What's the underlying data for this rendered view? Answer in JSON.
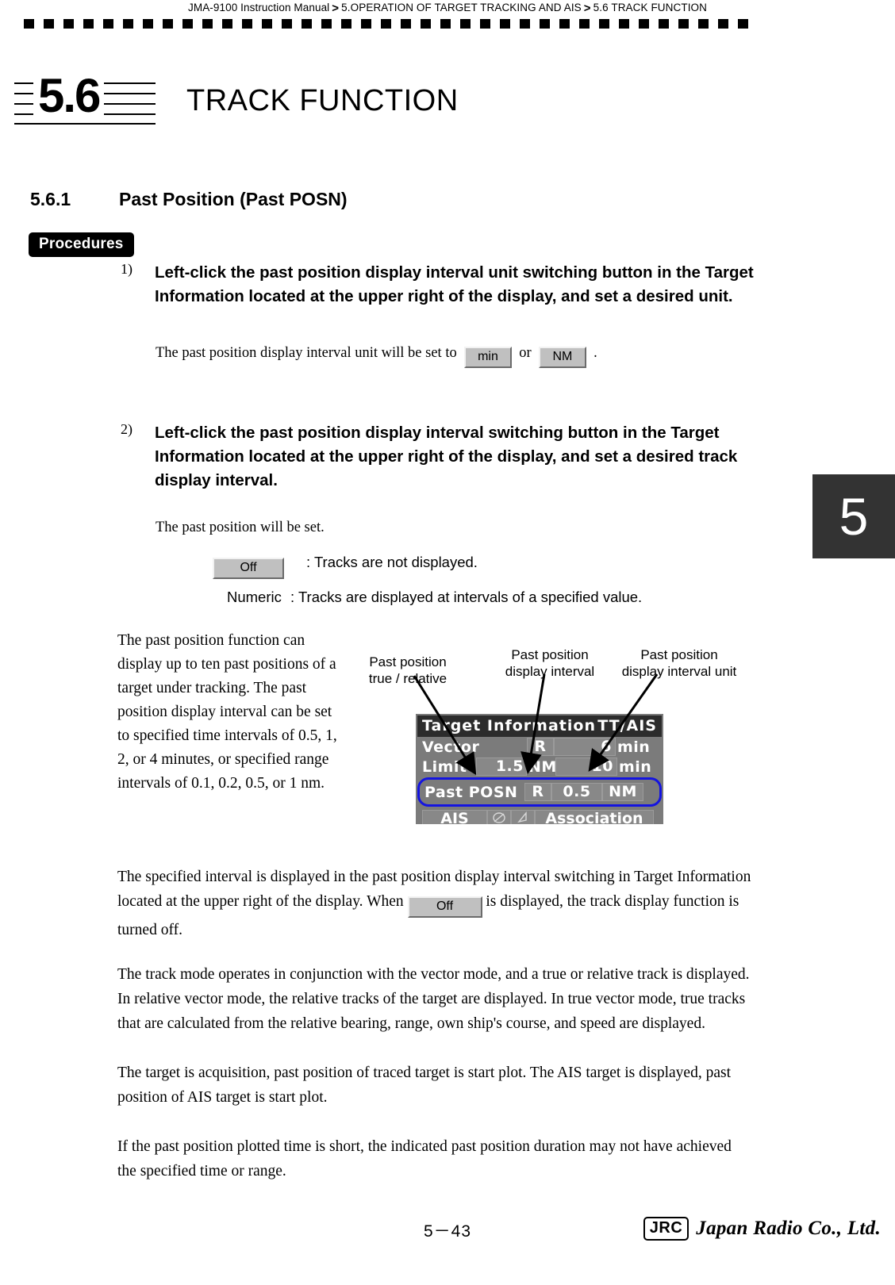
{
  "header": {
    "manual": "JMA-9100 Instruction Manual",
    "chapter": "5.OPERATION OF TARGET TRACKING AND AIS",
    "section": "5.6  TRACK FUNCTION",
    "separator": ">"
  },
  "section": {
    "number": "5.6",
    "title": "TRACK FUNCTION",
    "chapter_tab": "5"
  },
  "subsection": {
    "number": "5.6.1",
    "title": "Past Position (Past POSN)"
  },
  "procedures": {
    "tag": "Procedures",
    "steps": [
      {
        "marker": "1)",
        "text": "Left-click the past position display interval unit switching button in the Target Information located at the upper right of the display, and set a desired unit.",
        "note_before": "The past position display interval unit will be set to",
        "note_button_a": "min",
        "note_middle": "or",
        "note_button_b": "NM",
        "note_after": "."
      },
      {
        "marker": "2)",
        "text": "Left-click the past position display interval switching button in the Target Information located at the upper right of the display, and set a desired track display interval.",
        "note_before": "The past position will be set."
      }
    ]
  },
  "legend": {
    "off_button": "Off",
    "off_desc": ": Tracks are not displayed.",
    "numeric_word": "Numeric",
    "numeric_desc": ": Tracks are displayed at intervals of a specified value."
  },
  "left_column": {
    "text": "The past position function can display up to ten past positions of a target under tracking.  The past position display interval can be set to specified time intervals of 0.5, 1, 2, or 4 minutes, or specified range intervals of 0.1, 0.2, 0.5, or 1 nm."
  },
  "figure": {
    "callouts": [
      {
        "id": "true-relative",
        "line1": "Past position",
        "line2": "true / relative"
      },
      {
        "id": "display-interval",
        "line1": "Past position",
        "line2": "display interval"
      },
      {
        "id": "display-interval-unit",
        "line1": "Past position",
        "line2": "display interval unit"
      }
    ],
    "panel": {
      "title": "Target Information",
      "title_right": "TT/AIS",
      "rows": [
        {
          "label": "Vector",
          "field1": "",
          "field2": "R",
          "value": "6",
          "unit": "min"
        },
        {
          "label": "Limit",
          "field1": "1.5",
          "unit1": "NM",
          "field2": "",
          "value": "10",
          "unit": "min"
        },
        {
          "label": "Past  POSN",
          "field2": "R",
          "value": "0.5",
          "unit": "NM"
        }
      ],
      "bottom_row": {
        "label": "AIS",
        "association": "Association"
      }
    }
  },
  "paragraphs": {
    "p1_a": "The specified interval is displayed in the past position display interval switching in Target Information located at the upper right of the display. When",
    "p1_button": "Off",
    "p1_b": "is displayed, the track display function is turned off.",
    "p2": "The track mode operates in conjunction with the vector mode, and a true or relative track is displayed. In relative vector mode, the relative tracks of the target are displayed. In true vector mode, true tracks that are calculated from the relative bearing, range, own ship's course, and speed are displayed.",
    "p3": "The target is acquisition, past position of traced target is start plot. The AIS target is displayed, past position of AIS target is start plot.",
    "p4": "If the past position plotted time is short, the indicated past position duration may not have achieved the specified time or range."
  },
  "footer": {
    "page": "5－43",
    "logo_mark": "JRC",
    "logo_name": "Japan Radio Co., Ltd."
  },
  "colors": {
    "panel_bg": "#7b7b7b",
    "panel_title_bg": "#2c2c2c",
    "highlight": "#1414e0",
    "button_face": "#c0c0c0",
    "chapter_tab": "#333333"
  }
}
